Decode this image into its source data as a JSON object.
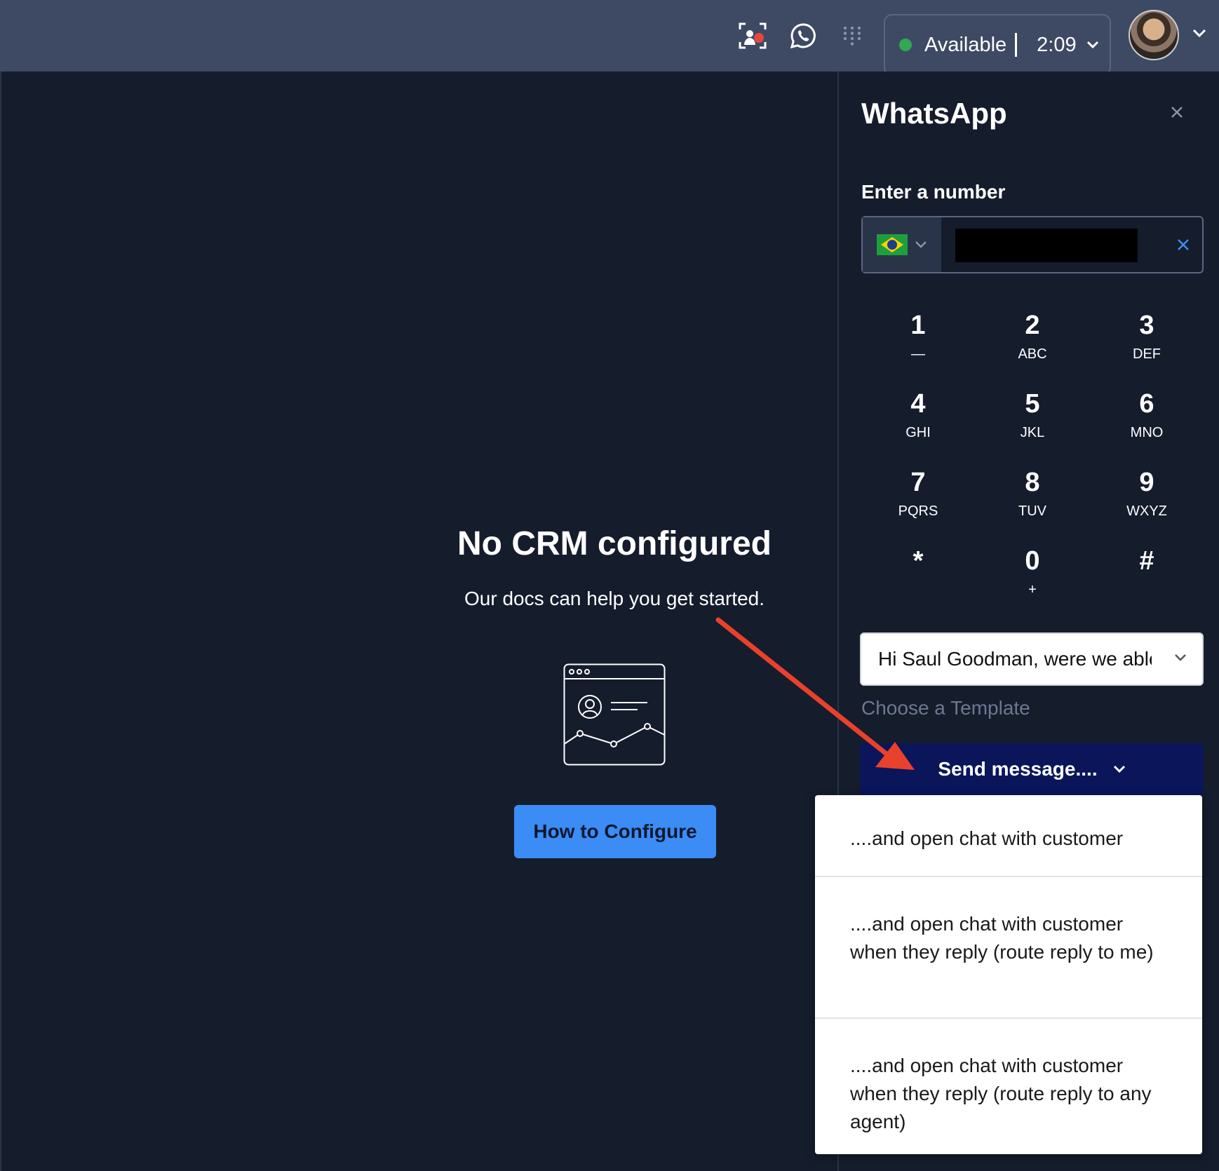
{
  "topbar": {
    "status_label": "Available",
    "timer": "2:09",
    "status_color": "#32a852",
    "icons": [
      "screen-record-icon",
      "whatsapp-icon",
      "grid-dots-icon",
      "chevron-down-icon"
    ]
  },
  "main": {
    "title": "No CRM configured",
    "subtitle": "Our docs can help you get started.",
    "configure_button": "How to Configure",
    "accent_color": "#3b8df5"
  },
  "whatsapp": {
    "title": "WhatsApp",
    "number_label": "Enter a number",
    "country": "Brazil",
    "number_value": "",
    "keypad": [
      {
        "digit": "1",
        "letters": "—"
      },
      {
        "digit": "2",
        "letters": "ABC"
      },
      {
        "digit": "3",
        "letters": "DEF"
      },
      {
        "digit": "4",
        "letters": "GHI"
      },
      {
        "digit": "5",
        "letters": "JKL"
      },
      {
        "digit": "6",
        "letters": "MNO"
      },
      {
        "digit": "7",
        "letters": "PQRS"
      },
      {
        "digit": "8",
        "letters": "TUV"
      },
      {
        "digit": "9",
        "letters": "WXYZ"
      },
      {
        "digit": "*",
        "letters": ""
      },
      {
        "digit": "0",
        "letters": "+"
      },
      {
        "digit": "#",
        "letters": ""
      }
    ],
    "template_value": "Hi Saul Goodman, were we able to help you?",
    "template_hint": "Choose a Template",
    "send_label": "Send message....",
    "send_color": "#0a1659",
    "send_options": [
      "....and open chat with customer",
      "....and open chat with customer when they reply (route reply to me)",
      "....and open chat with customer when they reply (route reply to any agent)"
    ]
  },
  "annotation_color": "#e8412c"
}
